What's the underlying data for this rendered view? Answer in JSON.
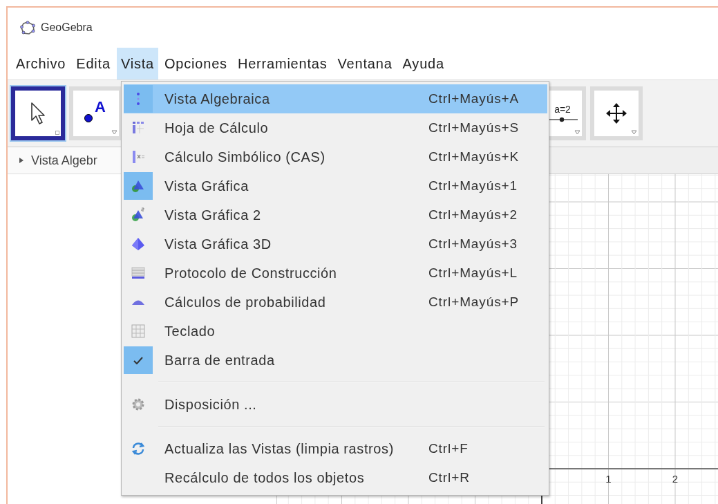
{
  "window": {
    "title": "GeoGebra"
  },
  "menu_bar": [
    {
      "label": "Archivo",
      "selected": false
    },
    {
      "label": "Edita",
      "selected": false
    },
    {
      "label": "Vista",
      "selected": true
    },
    {
      "label": "Opciones",
      "selected": false
    },
    {
      "label": "Herramientas",
      "selected": false
    },
    {
      "label": "Ventana",
      "selected": false
    },
    {
      "label": "Ayuda",
      "selected": false
    }
  ],
  "toolbar": [
    {
      "kind": "move",
      "selected": true
    },
    {
      "kind": "point",
      "label": "A",
      "selected": false
    },
    {
      "kind": "slider",
      "label": "a=2",
      "selected": false
    },
    {
      "kind": "move-view",
      "selected": false
    }
  ],
  "algebra_view": {
    "title": "Vista Algebr"
  },
  "graphics_view": {
    "x_labels": [
      "1",
      "2"
    ]
  },
  "dropdown": {
    "items": [
      {
        "kind": "item",
        "label": "Vista Algebraica",
        "shortcut": "Ctrl+Mayús+A",
        "selected": true,
        "checked": true
      },
      {
        "kind": "item",
        "label": "Hoja de Cálculo",
        "shortcut": "Ctrl+Mayús+S",
        "selected": false,
        "checked": false
      },
      {
        "kind": "item",
        "label": "Cálculo Simbólico (CAS)",
        "shortcut": "Ctrl+Mayús+K",
        "selected": false,
        "checked": false
      },
      {
        "kind": "item",
        "label": "Vista Gráfica",
        "shortcut": "Ctrl+Mayús+1",
        "selected": false,
        "checked": true
      },
      {
        "kind": "item",
        "label": "Vista Gráfica 2",
        "shortcut": "Ctrl+Mayús+2",
        "selected": false,
        "checked": false
      },
      {
        "kind": "item",
        "label": "Vista Gráfica 3D",
        "shortcut": "Ctrl+Mayús+3",
        "selected": false,
        "checked": false
      },
      {
        "kind": "item",
        "label": "Protocolo de Construcción",
        "shortcut": "Ctrl+Mayús+L",
        "selected": false,
        "checked": false
      },
      {
        "kind": "item",
        "label": "Cálculos de probabilidad",
        "shortcut": "Ctrl+Mayús+P",
        "selected": false,
        "checked": false
      },
      {
        "kind": "item",
        "label": "Teclado",
        "selected": false,
        "checked": false
      },
      {
        "kind": "item",
        "label": "Barra de entrada",
        "selected": false,
        "checked": true
      },
      {
        "kind": "separator"
      },
      {
        "kind": "item",
        "label": "Disposición ...",
        "selected": false,
        "checked": false
      },
      {
        "kind": "separator"
      },
      {
        "kind": "item",
        "label": "Actualiza las Vistas (limpia rastros)",
        "shortcut": "Ctrl+F",
        "selected": false,
        "checked": false
      },
      {
        "kind": "item",
        "label": "Recálculo de todos los objetos",
        "shortcut": "Ctrl+R",
        "selected": false,
        "checked": false
      }
    ]
  }
}
